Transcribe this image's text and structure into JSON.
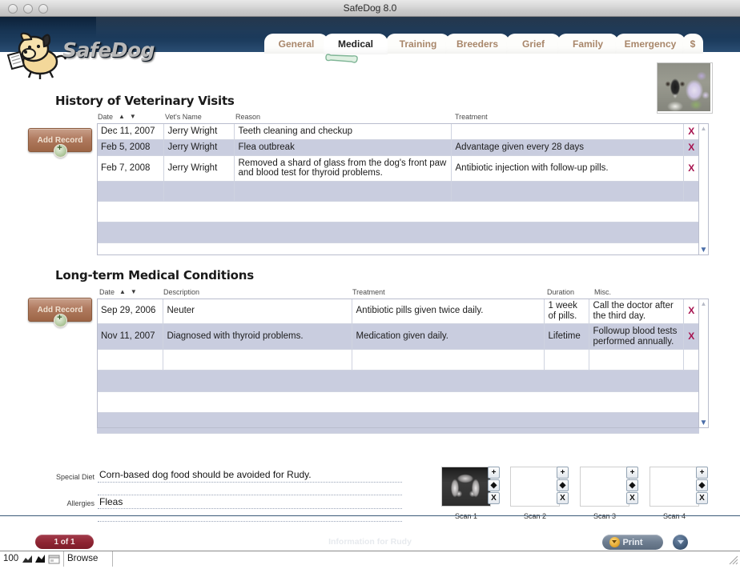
{
  "window": {
    "title": "SafeDog 8.0",
    "traffic_lights": [
      "close",
      "minimize",
      "zoom"
    ]
  },
  "header": {
    "app_name": "SafeDog",
    "logo_icon": "safedog-dog-logo-icon",
    "photo_alt": "dog-photo"
  },
  "tabs": [
    {
      "label": "General",
      "active": false
    },
    {
      "label": "Medical",
      "active": true
    },
    {
      "label": "Training",
      "active": false
    },
    {
      "label": "Breeders",
      "active": false
    },
    {
      "label": "Grief",
      "active": false
    },
    {
      "label": "Family",
      "active": false
    },
    {
      "label": "Emergency",
      "active": false
    },
    {
      "label": "$",
      "active": false
    }
  ],
  "vet_visits": {
    "title": "History of Veterinary Visits",
    "add_button_label": "Add Record",
    "columns": [
      "Date",
      "Vet's Name",
      "Reason",
      "Treatment",
      ""
    ],
    "sort_asc_icon": "sort-ascending-icon",
    "sort_desc_icon": "sort-descending-icon",
    "delete_icon": "delete-row-x-icon",
    "rows": [
      {
        "date": "Dec 11, 2007",
        "vet": "Jerry Wright",
        "reason": "Teeth cleaning and checkup",
        "treatment": ""
      },
      {
        "date": "Feb 5, 2008",
        "vet": "Jerry Wright",
        "reason": "Flea outbreak",
        "treatment": "Advantage given every 28 days"
      },
      {
        "date": "Feb 7, 2008",
        "vet": "Jerry Wright",
        "reason": "Removed a shard of glass from the dog's front paw and blood test for thyroid problems.",
        "treatment": "Antibiotic injection with follow-up pills."
      },
      {
        "date": "",
        "vet": "",
        "reason": "",
        "treatment": ""
      }
    ]
  },
  "conditions": {
    "title": "Long-term Medical Conditions",
    "add_button_label": "Add Record",
    "columns": [
      "Date",
      "Description",
      "Treatment",
      "Duration",
      "Misc.",
      ""
    ],
    "delete_icon": "delete-row-x-icon",
    "rows": [
      {
        "date": "Sep 29, 2006",
        "description": "Neuter",
        "treatment": "Antibiotic pills given twice daily.",
        "duration": "1 week of pills.",
        "misc": "Call the doctor after the third day."
      },
      {
        "date": "Nov 11, 2007",
        "description": "Diagnosed with thyroid problems.",
        "treatment": "Medication given daily.",
        "duration": "Lifetime",
        "misc": "Followup blood tests performed annually."
      },
      {
        "date": "",
        "description": "",
        "treatment": "",
        "duration": "",
        "misc": ""
      }
    ]
  },
  "fields": {
    "special_diet": {
      "label": "Special Diet",
      "value": "Corn-based dog food should be avoided for Rudy.",
      "placeholder": ""
    },
    "allergies": {
      "label": "Allergies",
      "value": "Fleas",
      "placeholder": ""
    }
  },
  "scans": {
    "button_icons": [
      "plus",
      "diamond",
      "x"
    ],
    "button_labels": [
      "+",
      "◆",
      "X"
    ],
    "items": [
      {
        "caption": "Scan 1",
        "has_image": true,
        "image_kind": "xray"
      },
      {
        "caption": "Scan 2",
        "has_image": false,
        "image_kind": ""
      },
      {
        "caption": "Scan 3",
        "has_image": false,
        "image_kind": ""
      },
      {
        "caption": "Scan 4",
        "has_image": false,
        "image_kind": ""
      }
    ]
  },
  "bottom": {
    "record_count": "1 of 1",
    "info_text": "Information for Rudy",
    "print_label": "Print",
    "print_icon": "print-chevron-icon",
    "menu_icon": "chevron-down-circle-icon"
  },
  "status": {
    "zoom_level": "100",
    "zoom_out_icon": "zoom-out-icon",
    "zoom_in_icon": "zoom-in-icon",
    "window_toggle_icon": "status-window-toggle-icon",
    "mode": "Browse"
  },
  "colors": {
    "header_navy": "#173453",
    "tab_text": "#a8866a",
    "row_alt": "#c9cddf",
    "grid_line": "#cfd3e0",
    "delete_x": "#a6134f",
    "add_record": "#b07a5f",
    "pill_red": "#8e2432"
  }
}
